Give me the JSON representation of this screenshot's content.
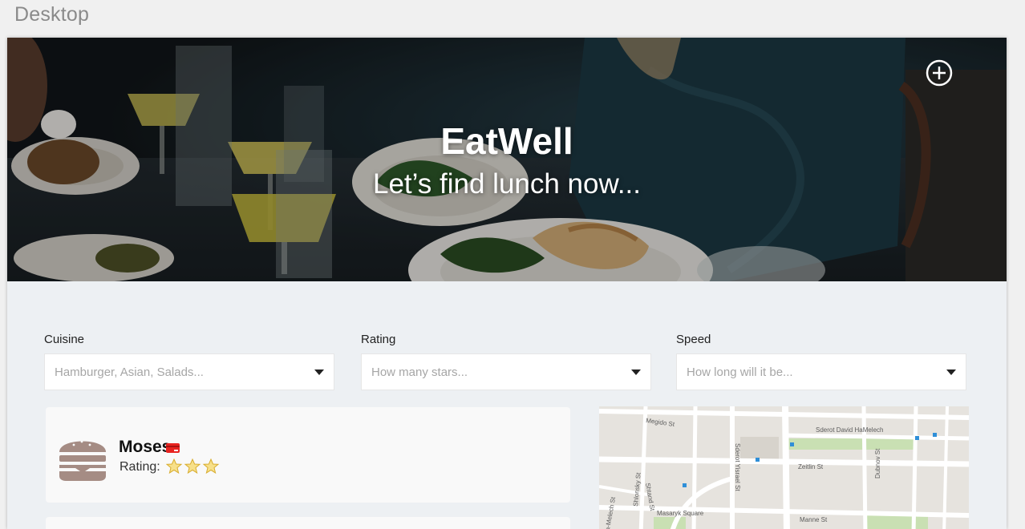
{
  "canvas": {
    "label": "Desktop"
  },
  "hero": {
    "title": "EatWell",
    "subtitle": "Let’s find lunch now..."
  },
  "filters": [
    {
      "label": "Cuisine",
      "placeholder": "Hamburger, Asian, Salads..."
    },
    {
      "label": "Rating",
      "placeholder": "How many stars..."
    },
    {
      "label": "Speed",
      "placeholder": "How long will it be..."
    }
  ],
  "restaurants": [
    {
      "name": "Moses",
      "rating_label": "Rating:",
      "stars": 3,
      "icon": "hamburger-icon",
      "badge_icon": "credit-card-icon"
    }
  ],
  "map": {
    "streets": [
      "Megido St",
      "Sderot David HaMelech",
      "Zeitlin St",
      "Dubnov St",
      "Sderot Yisrael St",
      "ha-Melech St",
      "Shlonsky St",
      "Shtand St",
      "Manne St",
      "Masaryk Square"
    ]
  },
  "colors": {
    "burger": "#a58c84",
    "card_badge": "#e8231f",
    "star": "#f3d25e",
    "frame_bg": "#edf0f3"
  }
}
